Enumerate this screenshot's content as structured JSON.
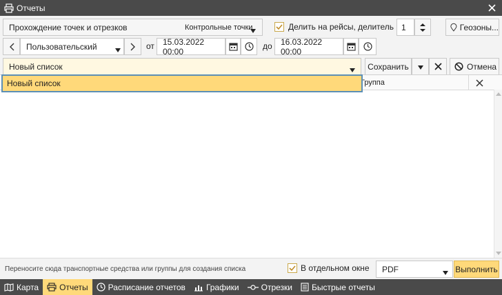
{
  "window": {
    "title": "Отчеты"
  },
  "toolbar": {
    "report_template": "Прохождение точек и отрезков",
    "report_subtype": "Контрольные точки",
    "split_trips_label": "Делить на рейсы, делитель №",
    "split_trips_checked": true,
    "divider_value": "1",
    "geozones_label": "Геозоны...",
    "interval_type": "Пользовательский",
    "from_label": "от",
    "from_value": "15.03.2022 00:00",
    "to_label": "до",
    "to_value": "16.03.2022 00:00"
  },
  "list_row": {
    "selected_list": "Новый список",
    "save_label": "Сохранить",
    "cancel_label": "Отмена"
  },
  "dropdown": {
    "options": [
      "Новый список"
    ]
  },
  "grid": {
    "group_header": "Группа"
  },
  "bottom": {
    "drop_hint": "Переносите сюда транспортные средства или группы для создания списка",
    "separate_window_label": "В отдельном окне",
    "separate_window_checked": true,
    "format_value": "PDF",
    "execute_label": "Выполнить"
  },
  "tabs": [
    {
      "label": "Карта",
      "icon": "map-icon"
    },
    {
      "label": "Отчеты",
      "icon": "printer-icon",
      "active": true
    },
    {
      "label": "Расписание отчетов",
      "icon": "clock-icon"
    },
    {
      "label": "Графики",
      "icon": "chart-icon"
    },
    {
      "label": "Отрезки",
      "icon": "segment-icon"
    },
    {
      "label": "Быстрые отчеты",
      "icon": "document-icon"
    }
  ],
  "colors": {
    "accent": "#ffd97a",
    "dark_bar": "#4a4a4a",
    "focus_border": "#5b8fb6"
  }
}
